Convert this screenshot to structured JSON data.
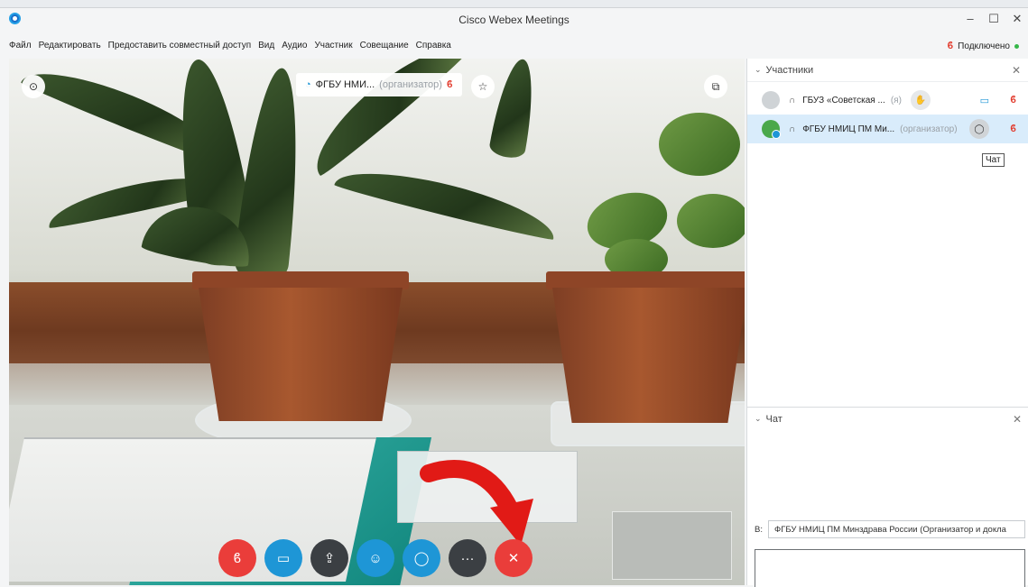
{
  "window": {
    "title": "Cisco Webex Meetings"
  },
  "menu": [
    "Файл",
    "Редактировать",
    "Предоставить совместный доступ",
    "Вид",
    "Аудио",
    "Участник",
    "Совещание",
    "Справка"
  ],
  "status": {
    "connection": "Подключено"
  },
  "video": {
    "active_speaker": "ФГБУ НМИ...",
    "active_speaker_role": "(организатор)"
  },
  "participants_panel": {
    "title": "Участники",
    "participants": [
      {
        "name": "ГБУЗ «Советская ...",
        "tag": "(я)"
      },
      {
        "name": "ФГБУ НМИЦ ПМ Ми...",
        "tag": "(организатор)"
      }
    ],
    "tooltip": "Чат"
  },
  "chat_panel": {
    "title": "Чат",
    "to_label": "В:",
    "to_value": "ФГБУ НМИЦ ПМ Минздрава России (Организатор и докла"
  },
  "icons": {
    "app": "webex-logo-icon",
    "mic": "mic-muted-icon",
    "camera": "camera-icon",
    "share": "share-icon",
    "participants": "participants-icon",
    "chat": "chat-icon",
    "more": "more-icon",
    "end": "end-call-icon"
  },
  "colors": {
    "accent": "#1e96d6",
    "end_call": "#ea3d3a",
    "connected": "#36b749"
  }
}
